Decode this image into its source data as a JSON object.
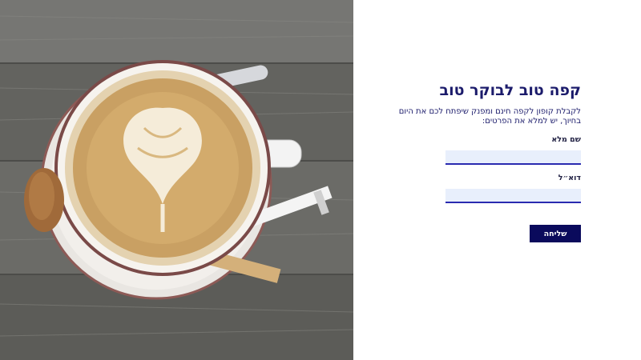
{
  "hero": {
    "icon": "coffee-cup-photo",
    "colors": {
      "wood": "#6f6f6c",
      "cup_rim": "#7a4a48",
      "latte": "#c9a063",
      "foam": "#f5ecd9"
    }
  },
  "form": {
    "title": "קפה טוב לבוקר טוב",
    "intro": "לקבלת קופון לקפה חינם ומפנק שיפתח לכם את היום בחיוך, יש למלא את הפרטים:",
    "name_label": "שם מלא",
    "name_value": "",
    "email_label": "דוא״ל",
    "email_value": "",
    "submit_label": "שליחה",
    "colors": {
      "title": "#1b1b6b",
      "field_bg": "#e8effc",
      "field_border": "#2a2ab0",
      "button_bg": "#0a0a5c"
    }
  }
}
